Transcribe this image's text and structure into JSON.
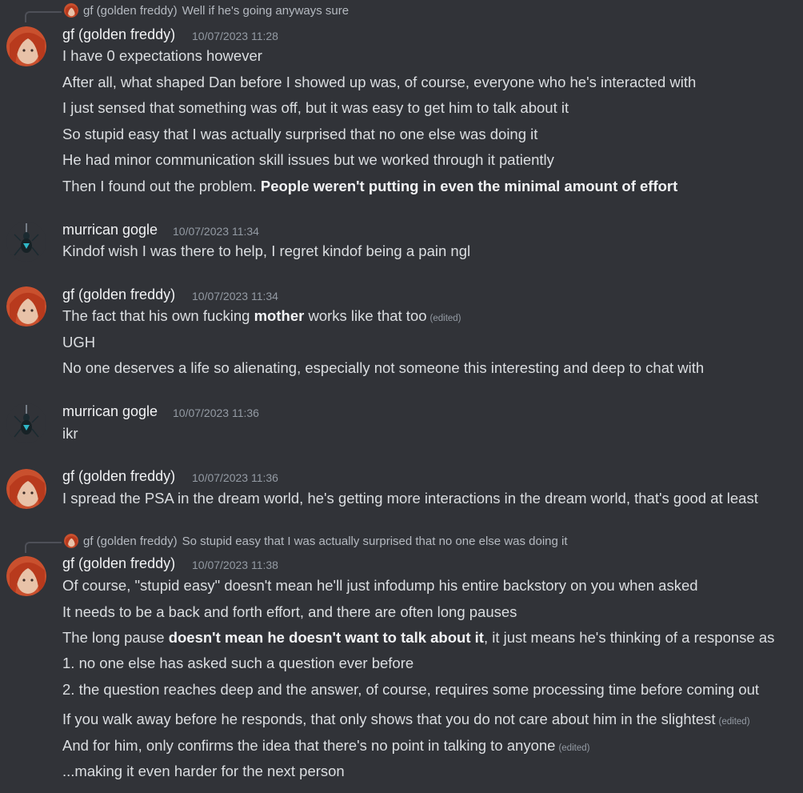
{
  "colors": {
    "background": "#313338",
    "text": "#dbdee1",
    "name": "#f2f3f5",
    "timestamp": "#949ba4"
  },
  "reply1": {
    "author": "gf (golden freddy)",
    "text": "Well if he's going anyways sure"
  },
  "msg1": {
    "author": "gf (golden freddy)",
    "time": "10/07/2023 11:28",
    "lines": [
      "I have 0 expectations however",
      "After all, what shaped Dan before I showed up was, of course, everyone who he's interacted with",
      "I just sensed that something was off, but it was easy to get him to talk about it",
      "So stupid easy that I was actually surprised that no one else was doing it",
      "He had minor communication skill issues but we worked through it patiently"
    ],
    "line6_prefix": "Then I found out the problem. ",
    "line6_bold": "People weren't putting in even the minimal amount of effort"
  },
  "msg2": {
    "author": "murrican gogle",
    "time": "10/07/2023 11:34",
    "text": "Kindof wish I was there to help, I regret kindof being a pain ngl"
  },
  "msg3": {
    "author": "gf (golden freddy)",
    "time": "10/07/2023 11:34",
    "line1_prefix": "The fact that his own fucking ",
    "line1_bold": "mother",
    "line1_suffix": " works like that too",
    "edited": "(edited)",
    "line2": "UGH",
    "line3": "No one deserves a life so alienating, especially not someone this interesting and deep to chat with"
  },
  "msg4": {
    "author": "murrican gogle",
    "time": "10/07/2023 11:36",
    "text": "ikr"
  },
  "msg5": {
    "author": "gf (golden freddy)",
    "time": "10/07/2023 11:36",
    "text": "I spread the PSA in the dream world, he's getting more interactions in the dream world, that's good at least"
  },
  "reply2": {
    "author": "gf (golden freddy)",
    "text": "So stupid easy that I was actually surprised that no one else was doing it"
  },
  "msg6": {
    "author": "gf (golden freddy)",
    "time": "10/07/2023 11:38",
    "line1": "Of course, \"stupid easy\" doesn't mean he'll just infodump his entire backstory on you when asked",
    "line2": "It needs to be a back and forth effort, and there are often long pauses",
    "line3_prefix": "The long pause ",
    "line3_bold": "doesn't mean he doesn't want to talk about it",
    "line3_suffix": ", it just means he's thinking of a response as",
    "list1": "1. no one else has asked such a question ever before",
    "list2": "2. the question reaches deep and the answer, of course, requires some processing time before coming out",
    "line7": "If you walk away before he responds, that only shows that you do not care about him in the slightest",
    "line7_edited": "(edited)",
    "line8": "And for him, only confirms the idea that there's no point in talking to anyone",
    "line8_edited": "(edited)",
    "line9": "...making it even harder for the next person"
  }
}
